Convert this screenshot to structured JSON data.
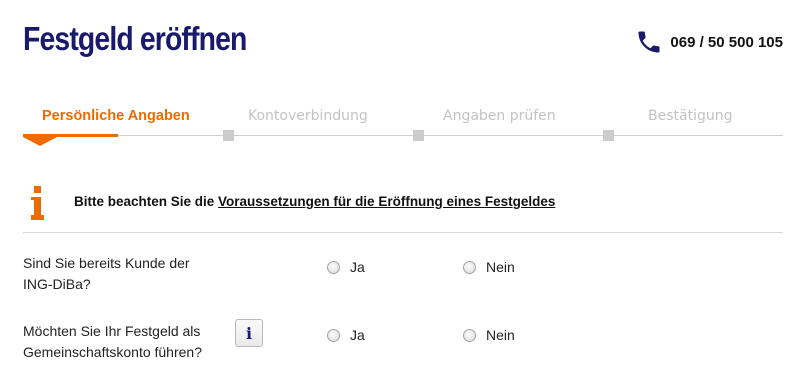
{
  "header": {
    "title": "Festgeld eröffnen",
    "phone": "069 / 50 500 105"
  },
  "steps": [
    {
      "label": "Persönliche Angaben",
      "state": "active"
    },
    {
      "label": "Kontoverbindung",
      "state": "inactive"
    },
    {
      "label": "Angaben prüfen",
      "state": "inactive"
    },
    {
      "label": "Bestätigung",
      "state": "inactive"
    }
  ],
  "notice": {
    "prefix": "Bitte beachten Sie die ",
    "link": "Voraussetzungen für die Eröffnung eines Festgeldes",
    "icon": "info-icon"
  },
  "questions": [
    {
      "line1": "Sind Sie bereits Kunde der",
      "line2": "ING-DiBa?",
      "yes": "Ja",
      "no": "Nein",
      "selected": null
    },
    {
      "line1": "Möchten Sie Ihr Festgeld als",
      "line2": "Gemeinschaftskonto führen?",
      "yes": "Ja",
      "no": "Nein",
      "selected": null,
      "help_icon": "i"
    }
  ],
  "colors": {
    "brand_dark": "#1a1a6b",
    "accent": "#ee6b00",
    "inactive": "#c3c3c3"
  }
}
